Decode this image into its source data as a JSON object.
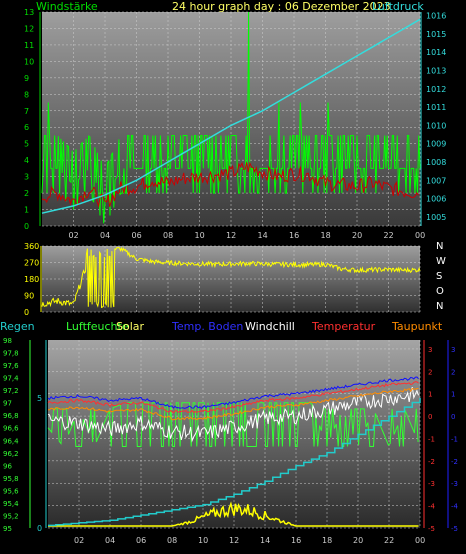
{
  "header": {
    "title": "24 hour graph day : 06 Dezember 2023",
    "left_label": "Windstärke",
    "right_label": "Luftdruck"
  },
  "legend": {
    "regen": "Regen",
    "luftfeuchte": "Luftfeuchte",
    "solar": "Solar",
    "temp_boden": "Temp. Boden",
    "windchill": "Windchill",
    "temperatur": "Temperatur",
    "taupunkt": "Taupunkt"
  },
  "colors": {
    "wind": "#00ff00",
    "gust": "#cc0000",
    "pressure": "#33dddd",
    "direction": "#ffff00",
    "humidity": "#33ff33",
    "solar": "#ffff00",
    "temp_boden": "#1010ff",
    "windchill": "#ffffff",
    "temperatur": "#ff3030",
    "taupunkt": "#ff8c00",
    "regen": "#22cccc"
  },
  "chart_data": [
    {
      "type": "line",
      "title": "24 hour graph day : 06 Dezember 2023",
      "xlabel": "",
      "x_ticks": [
        "02",
        "04",
        "06",
        "08",
        "10",
        "12",
        "14",
        "16",
        "18",
        "20",
        "22",
        "00"
      ],
      "left_axis": {
        "label": "Windstärke",
        "ticks": [
          "0",
          "1",
          "2",
          "3",
          "4",
          "5",
          "6",
          "7",
          "8",
          "9",
          "10",
          "11",
          "12",
          "13"
        ],
        "range": [
          0,
          13
        ]
      },
      "right_axis": {
        "label": "Luftdruck",
        "ticks": [
          "1005",
          "1006",
          "1007",
          "1008",
          "1009",
          "1010",
          "1011",
          "1012",
          "1013",
          "1014",
          "1015",
          "1016"
        ],
        "range": [
          1004.5,
          1016.2
        ]
      },
      "series": [
        {
          "name": "Windstärke",
          "hours": [
            0,
            1,
            2,
            3,
            4,
            5,
            6,
            7,
            8,
            9,
            10,
            11,
            12,
            13,
            14,
            15,
            16,
            17,
            18,
            19,
            20,
            21,
            22,
            23,
            24
          ],
          "values": [
            3.5,
            3.5,
            2.5,
            3.5,
            1.5,
            3.5,
            3.5,
            3.5,
            3.5,
            3.5,
            3.5,
            3.5,
            3.5,
            3.5,
            3.5,
            3.5,
            3.5,
            3.5,
            3.5,
            3.5,
            3.5,
            3.5,
            3.5,
            3.5,
            3.5
          ]
        },
        {
          "hours": [
            0,
            1,
            2,
            3,
            4,
            5,
            6,
            7,
            8,
            9,
            10,
            11,
            12,
            13,
            14,
            15,
            16,
            17,
            18,
            19,
            20,
            21,
            22,
            23,
            24
          ],
          "values": [
            1.8,
            2.0,
            1.5,
            2.2,
            1.3,
            2.3,
            2.4,
            2.8,
            2.6,
            2.9,
            3.0,
            3.1,
            3.2,
            3.6,
            3.3,
            3.0,
            3.2,
            3.1,
            2.6,
            2.5,
            2.4,
            2.6,
            2.3,
            2.1,
            2.0
          ]
        },
        {
          "name": "Luftdruck",
          "hours": [
            0,
            1,
            2,
            3,
            4,
            5,
            6,
            7,
            8,
            9,
            10,
            11,
            12,
            13,
            14,
            15,
            16,
            17,
            18,
            19,
            20,
            21,
            22,
            23,
            24
          ],
          "values": [
            1005.2,
            1005.4,
            1005.6,
            1005.9,
            1006.2,
            1006.6,
            1007.0,
            1007.5,
            1008.0,
            1008.5,
            1009.0,
            1009.5,
            1010.0,
            1010.4,
            1010.8,
            1011.3,
            1011.8,
            1012.3,
            1012.8,
            1013.3,
            1013.8,
            1014.3,
            1014.8,
            1015.3,
            1015.8
          ]
        }
      ]
    },
    {
      "type": "line",
      "x_ticks": [
        "02",
        "04",
        "06",
        "08",
        "10",
        "12",
        "14",
        "16",
        "18",
        "20",
        "22",
        "00"
      ],
      "left_axis": {
        "ticks": [
          "0",
          "90",
          "180",
          "270",
          "360"
        ],
        "range": [
          0,
          360
        ]
      },
      "right_axis": {
        "ticks": [
          "N",
          "W",
          "S",
          "O",
          "N"
        ]
      },
      "series": [
        {
          "hours": [
            0,
            1,
            2,
            3,
            4,
            5,
            6,
            7,
            8,
            9,
            10,
            11,
            12,
            13,
            14,
            15,
            16,
            17,
            18,
            19,
            20,
            21,
            22,
            23,
            24
          ],
          "values": [
            45,
            60,
            40,
            300,
            340,
            345,
            290,
            275,
            268,
            265,
            262,
            260,
            262,
            265,
            262,
            260,
            258,
            258,
            260,
            235,
            228,
            230,
            232,
            228,
            230
          ]
        }
      ]
    },
    {
      "type": "line",
      "x_ticks": [
        "02",
        "04",
        "06",
        "08",
        "10",
        "12",
        "14",
        "16",
        "18",
        "20",
        "22",
        "00"
      ],
      "left_axis": {
        "label": "Luftfeuchte",
        "ticks": [
          "95",
          "95,2",
          "95,4",
          "95,6",
          "95,8",
          "96",
          "96,2",
          "96,4",
          "96,6",
          "96,8",
          "97",
          "97,2",
          "97,4",
          "97,6",
          "97,8",
          "98"
        ],
        "range": [
          95,
          98
        ]
      },
      "rain_axis": {
        "label": "Regen",
        "ticks": [
          "0",
          "5"
        ]
      },
      "right_axis_red": {
        "label": "Temperatur",
        "ticks": [
          "-5",
          "-4",
          "-3",
          "-2",
          "-1",
          "0",
          "1",
          "2",
          "3"
        ]
      },
      "right_axis_blue": {
        "label": "Temp. Boden",
        "ticks": [
          "-5",
          "-4",
          "-3",
          "-2",
          "-1",
          "0",
          "1",
          "2",
          "3"
        ]
      },
      "series": [
        {
          "name": "Luftfeuchte",
          "hours": [
            0,
            1,
            2,
            3,
            4,
            5,
            6,
            7,
            8,
            9,
            10,
            11,
            12,
            13,
            14,
            15,
            16,
            17,
            18,
            19,
            20,
            21,
            22,
            23,
            24
          ],
          "values": [
            96.6,
            96.3,
            96.9,
            96.3,
            96.9,
            97.0,
            97.0,
            97.0,
            97.0,
            97.0,
            97.0,
            97.0,
            97.0,
            97.0,
            97.0,
            97.0,
            97.0,
            97.0,
            96.3,
            96.9,
            96.3,
            96.9,
            96.3,
            96.9,
            96.3
          ]
        },
        {
          "name": "Temp. Boden",
          "hours": [
            0,
            2,
            4,
            6,
            8,
            10,
            12,
            14,
            16,
            18,
            20,
            22,
            24
          ],
          "values": [
            0.8,
            0.9,
            0.7,
            0.8,
            0.4,
            0.4,
            0.6,
            0.9,
            1.0,
            1.2,
            1.4,
            1.6,
            1.7
          ]
        },
        {
          "name": "Temperatur",
          "hours": [
            0,
            2,
            4,
            6,
            8,
            10,
            12,
            14,
            16,
            18,
            20,
            22,
            24
          ],
          "values": [
            0.6,
            0.7,
            0.5,
            0.6,
            0.2,
            0.2,
            0.4,
            0.7,
            0.8,
            1.0,
            1.2,
            1.4,
            1.5
          ]
        },
        {
          "name": "Taupunkt",
          "hours": [
            0,
            2,
            4,
            6,
            8,
            10,
            12,
            14,
            16,
            18,
            20,
            22,
            24
          ],
          "values": [
            0.3,
            0.4,
            0.2,
            0.3,
            -0.1,
            -0.1,
            0.1,
            0.4,
            0.5,
            0.7,
            0.9,
            1.1,
            1.2
          ]
        },
        {
          "name": "Windchill",
          "hours": [
            0,
            2,
            4,
            6,
            8,
            10,
            12,
            14,
            16,
            18,
            20,
            22,
            24
          ],
          "values": [
            -0.2,
            -0.3,
            -0.6,
            -0.3,
            -0.7,
            -0.8,
            -0.5,
            -0.1,
            0.0,
            0.3,
            0.6,
            0.8,
            1.0
          ]
        },
        {
          "name": "Regen",
          "hours": [
            0,
            2,
            4,
            6,
            8,
            10,
            12,
            14,
            16,
            18,
            20,
            22,
            24
          ],
          "values": [
            0.1,
            0.2,
            0.3,
            0.5,
            0.7,
            0.9,
            1.3,
            1.8,
            2.4,
            2.9,
            3.6,
            4.3,
            5.0
          ]
        },
        {
          "name": "Solar",
          "hours": [
            8,
            9,
            10,
            11,
            12,
            13,
            14,
            15,
            16
          ],
          "values": [
            0,
            0.2,
            0.5,
            0.8,
            1.0,
            0.9,
            0.6,
            0.3,
            0
          ]
        }
      ]
    }
  ]
}
